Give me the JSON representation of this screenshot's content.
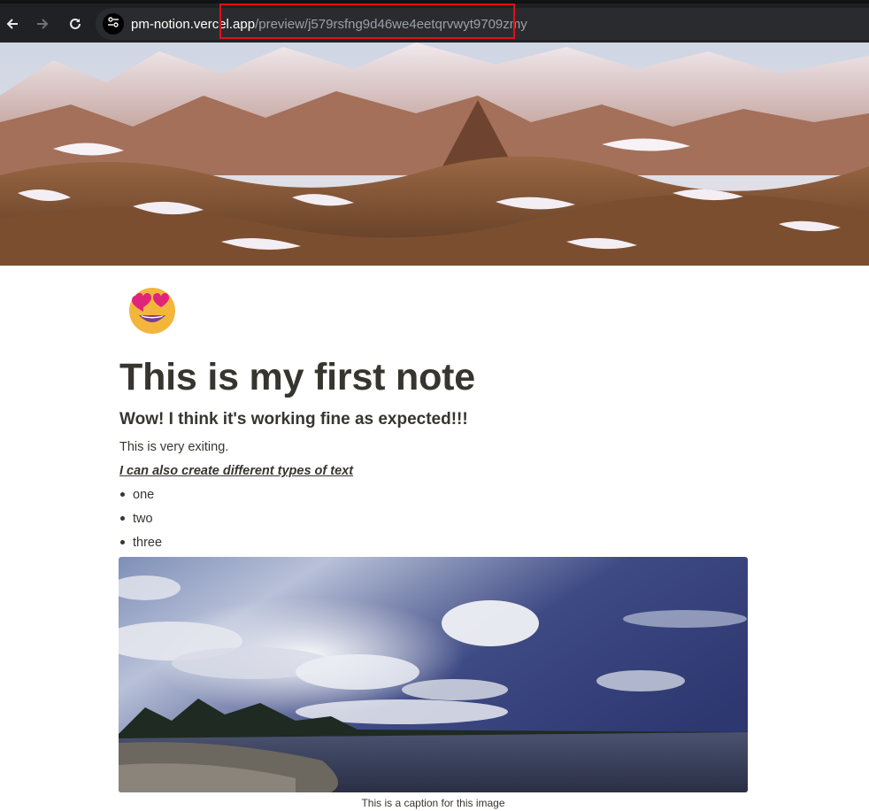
{
  "browser": {
    "back_icon": "arrow-left-icon",
    "forward_icon": "arrow-right-icon",
    "reload_icon": "reload-icon",
    "site_info_icon": "tune-icon",
    "url_domain": "pm-notion.vercel.app",
    "url_path": "/preview/j579rsfng9d46we4eetqrvwyt9709zmy",
    "highlight_color": "#e0101a"
  },
  "page": {
    "cover_image": "snowy mountain range",
    "icon": "smiling-face-with-heart-eyes",
    "title": "This is my first note",
    "heading": "Wow! I think it's working fine as expected!!!",
    "paragraph": "This is very exiting.",
    "styled_text": "I can also create different types of text",
    "bullets": [
      "one",
      "two",
      "three"
    ],
    "image": "sky with clouds over a lake",
    "caption": "This is a caption for this image"
  }
}
